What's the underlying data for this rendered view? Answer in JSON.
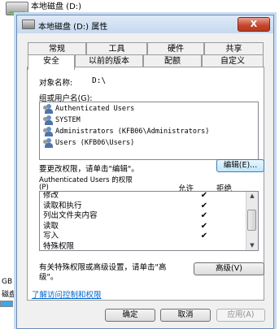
{
  "explorer": {
    "drive_label": "本地磁盘 (D:)",
    "left_size_fragment": "GB",
    "left_disk_fragment": "磁盘"
  },
  "dialog": {
    "title": "本地磁盘 (D:) 属性",
    "close_symbol": "X"
  },
  "tabs": {
    "row1": [
      "常规",
      "工具",
      "硬件",
      "共享"
    ],
    "row2": [
      "安全",
      "以前的版本",
      "配额",
      "自定义"
    ],
    "active": "安全"
  },
  "security": {
    "object_name_label": "对象名称:",
    "object_name_value": "D:\\",
    "groups_label": "组或用户名(G):",
    "groups": [
      "Authenticated Users",
      "SYSTEM",
      "Administrators (KFB06\\Administrators)",
      "Users (KFB06\\Users)"
    ],
    "change_hint": "要更改权限，请单击\"编辑\"。",
    "edit_button": "编辑(E)...",
    "permissions_for_line1": "Authenticated Users 的权限",
    "permissions_for_line2": "(P)",
    "allow_header": "允许",
    "deny_header": "拒绝",
    "permissions": [
      {
        "name": "修改",
        "allow": "✔",
        "deny": ""
      },
      {
        "name": "读取和执行",
        "allow": "✔",
        "deny": ""
      },
      {
        "name": "列出文件夹内容",
        "allow": "✔",
        "deny": ""
      },
      {
        "name": "读取",
        "allow": "✔",
        "deny": ""
      },
      {
        "name": "写入",
        "allow": "✔",
        "deny": ""
      },
      {
        "name": "特殊权限",
        "allow": "",
        "deny": ""
      }
    ],
    "advanced_hint_line1": "有关特殊权限或高级设置，请单击\"高",
    "advanced_hint_line2": "级\"。",
    "advanced_button": "高级(V)",
    "learn_link": "了解访问控制和权限"
  },
  "buttons": {
    "ok": "确定",
    "cancel": "取消",
    "apply": "应用(A)"
  }
}
